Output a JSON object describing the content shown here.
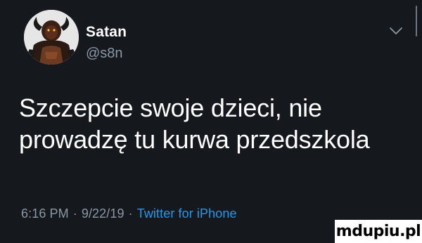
{
  "tweet": {
    "author": {
      "display_name": "Satan",
      "handle": "@s8n",
      "avatar_icon": "devil-avatar-icon"
    },
    "menu_icon": "chevron-down-icon",
    "text_lines": [
      "Szczepcie swoje dzieci, nie",
      "prowadzę tu kurwa przedszkola"
    ],
    "meta": {
      "time": "6:16 PM",
      "date": "9/22/19",
      "source": "Twitter for iPhone",
      "separator": "·"
    }
  },
  "watermark": {
    "text": "mdupiu.pl"
  },
  "colors": {
    "background": "#15181d",
    "secondary_text": "#8b98a5",
    "link": "#1d9bf0"
  }
}
